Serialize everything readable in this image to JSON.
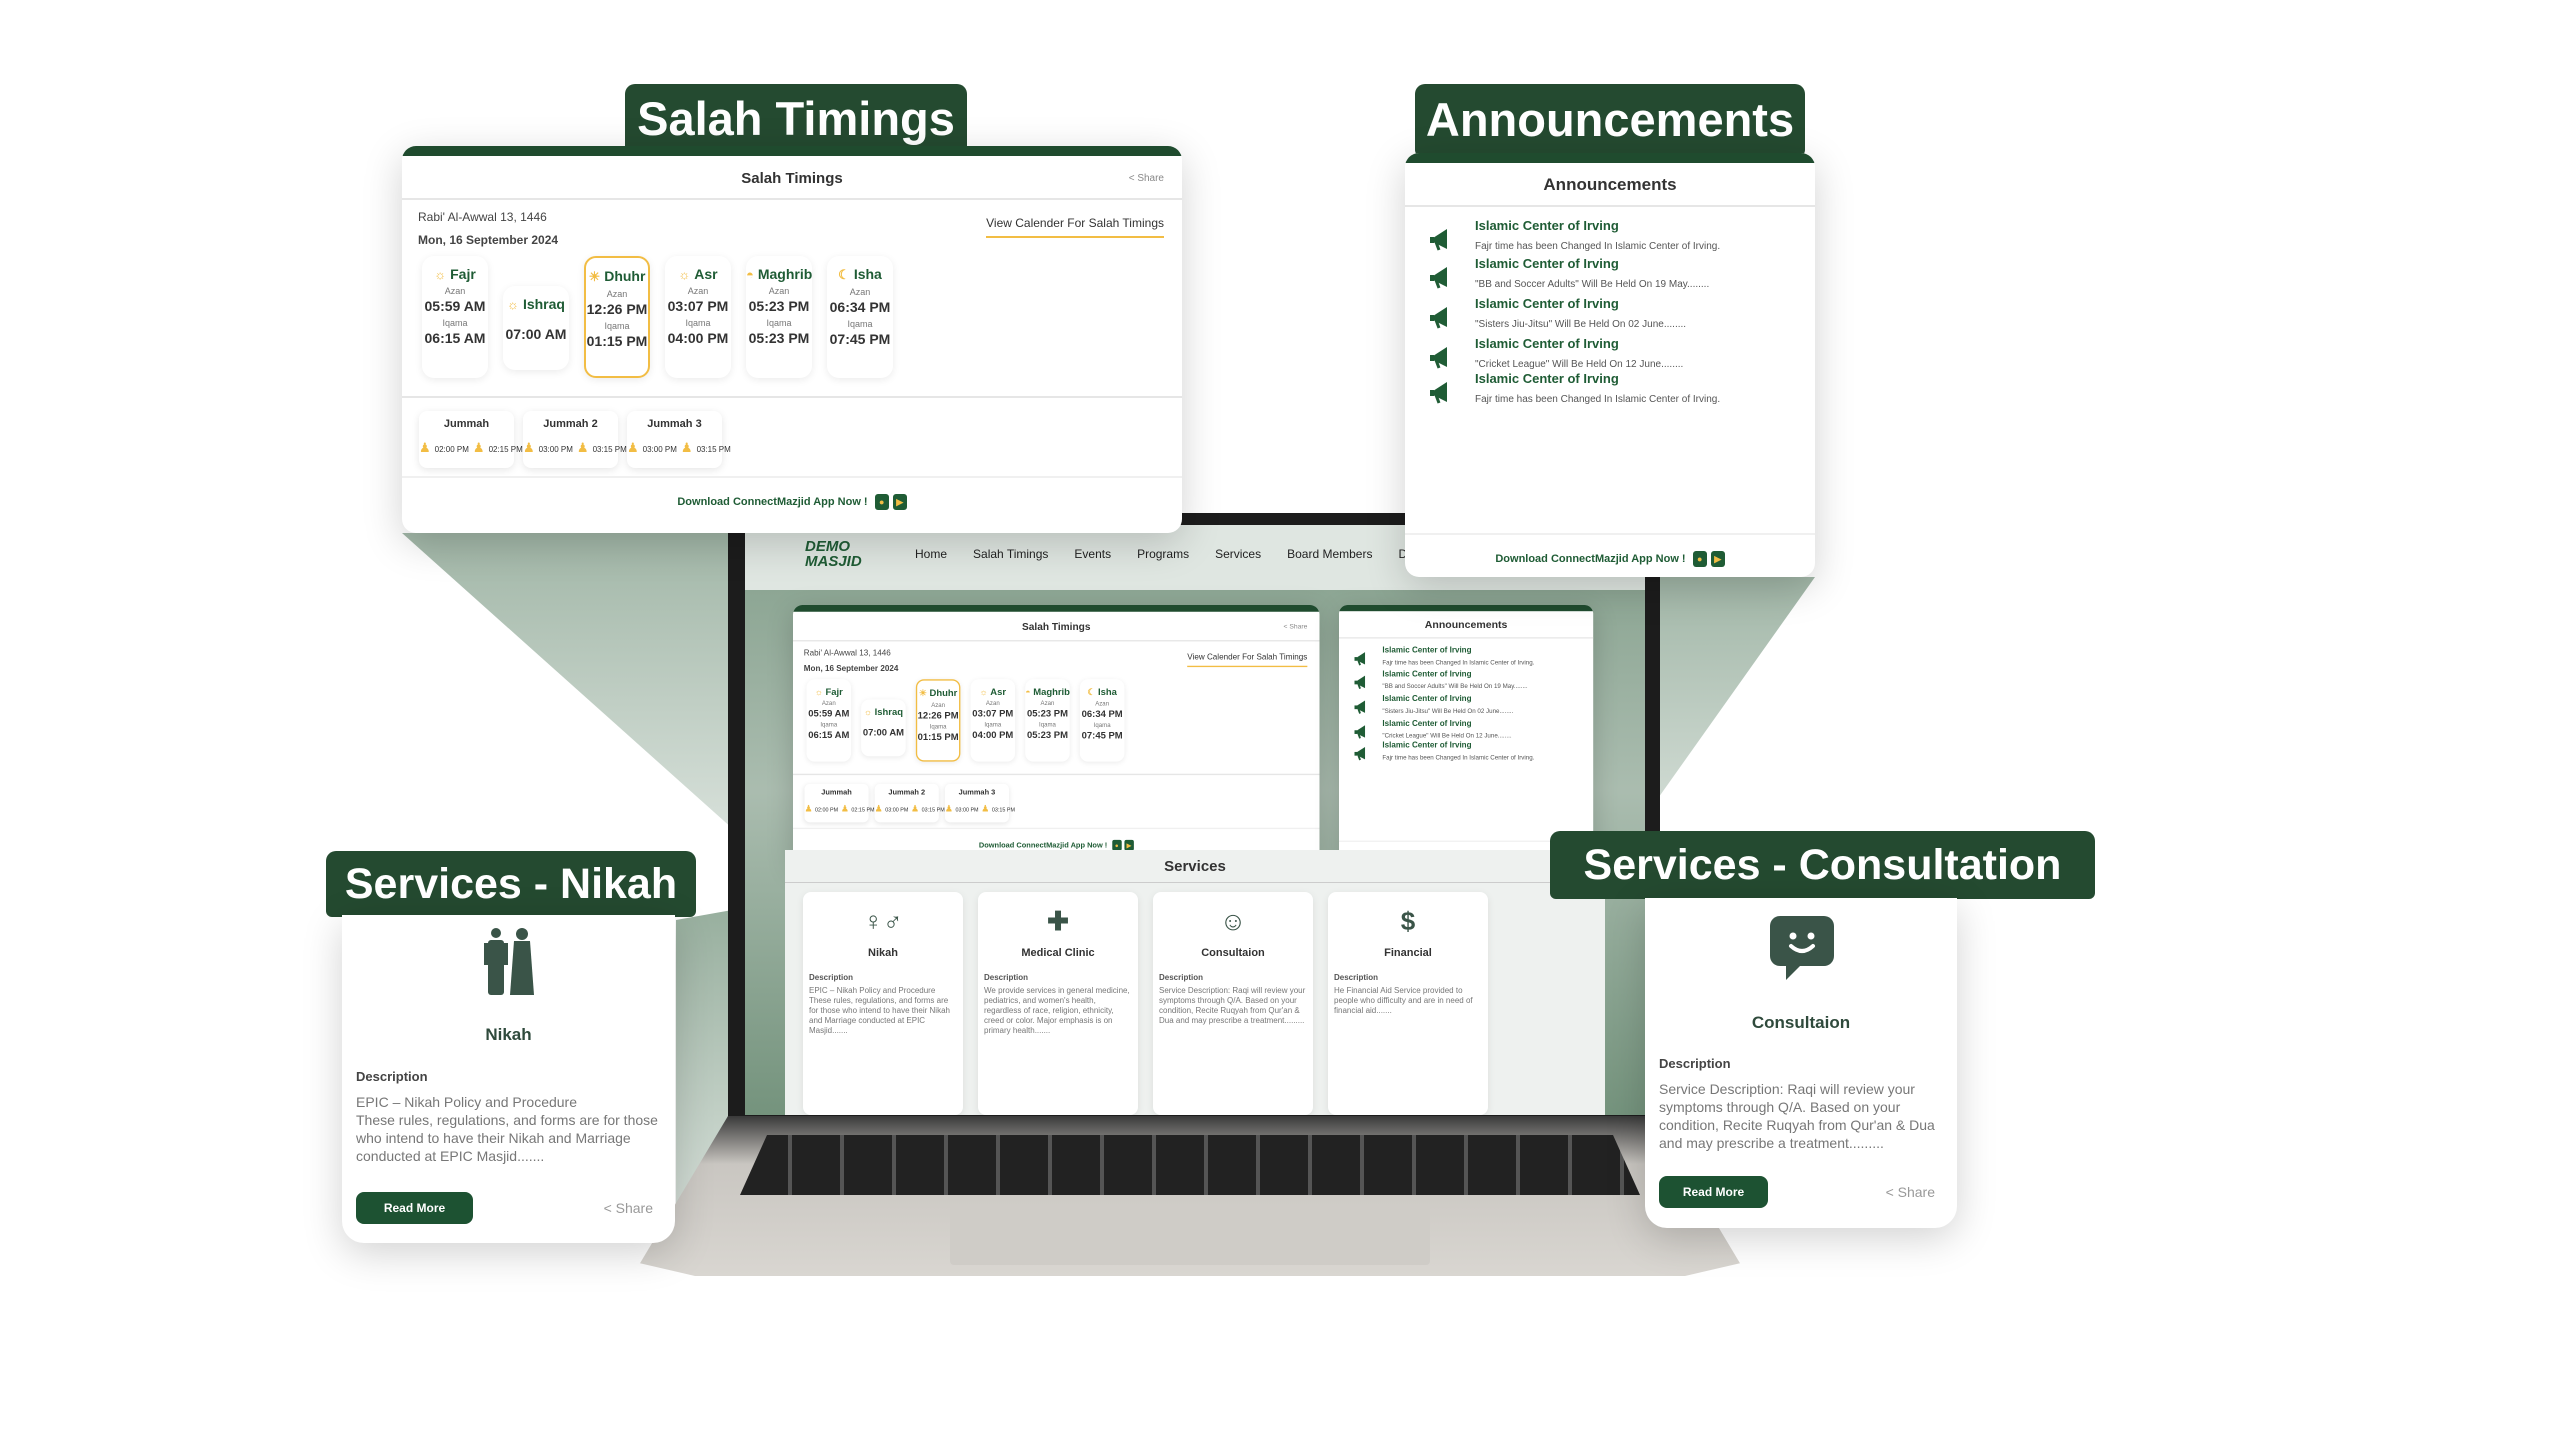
{
  "labels": {
    "salah": "Salah Timings",
    "announcements": "Announcements",
    "nikah": "Services - Nikah",
    "consultation": "Services - Consultation"
  },
  "salah": {
    "title": "Salah Timings",
    "share": "Share",
    "hijri": "Rabi' Al-Awwal 13, 1446",
    "date": "Mon, 16 September 2024",
    "calendar_link": "View Calender For Salah Timings",
    "azan_label": "Azan",
    "iqama_label": "Iqama",
    "prayers": [
      {
        "name": "Fajr",
        "icon": "sunrise-icon",
        "azan": "05:59 AM",
        "iqama": "06:15 AM"
      },
      {
        "name": "Ishraq",
        "icon": "sunrise-icon",
        "time": "07:00 AM"
      },
      {
        "name": "Dhuhr",
        "icon": "sun-icon",
        "azan": "12:26 PM",
        "iqama": "01:15 PM",
        "active": true
      },
      {
        "name": "Asr",
        "icon": "sun-down-icon",
        "azan": "03:07 PM",
        "iqama": "04:00 PM"
      },
      {
        "name": "Maghrib",
        "icon": "sunset-icon",
        "azan": "05:23 PM",
        "iqama": "05:23 PM"
      },
      {
        "name": "Isha",
        "icon": "moon-icon",
        "azan": "06:34 PM",
        "iqama": "07:45 PM"
      }
    ],
    "jummah": [
      {
        "name": "Jummah",
        "khutbah": "02:00 PM",
        "salah": "02:15 PM"
      },
      {
        "name": "Jummah 2",
        "khutbah": "03:00 PM",
        "salah": "03:15 PM"
      },
      {
        "name": "Jummah 3",
        "khutbah": "03:00 PM",
        "salah": "03:15 PM"
      }
    ],
    "download": "Download ConnectMazjid App Now !"
  },
  "announcements": {
    "title": "Announcements",
    "items": [
      {
        "title": "Islamic Center of Irving",
        "text": "Fajr time has been Changed In Islamic Center of Irving."
      },
      {
        "title": "Islamic Center of Irving",
        "text": "\"BB and Soccer Adults\" Will Be Held On 19 May........"
      },
      {
        "title": "Islamic Center of Irving",
        "text": "\"Sisters Jiu-Jitsu\" Will Be Held On 02 June........"
      },
      {
        "title": "Islamic Center of Irving",
        "text": "\"Cricket League\" Will Be Held On 12 June........"
      },
      {
        "title": "Islamic Center of Irving",
        "text": "Fajr time has been Changed In Islamic Center of Irving."
      }
    ],
    "download": "Download ConnectMazjid App Now !"
  },
  "site": {
    "logo": "DEMO\nMASJID",
    "nav": [
      "Home",
      "Salah Timings",
      "Events",
      "Programs",
      "Services",
      "Board Members",
      "Don"
    ],
    "services_title": "Services",
    "services": [
      {
        "name": "Nikah",
        "icon": "couple-icon",
        "desc": "EPIC – Nikah Policy and Procedure These rules, regulations, and forms are for those who intend to have their Nikah and Marriage conducted at EPIC Masjid......."
      },
      {
        "name": "Medical Clinic",
        "icon": "medical-kit-icon",
        "desc": "We provide services in general medicine, pediatrics, and women's health, regardless of race, religion, ethnicity, creed or color. Major emphasis is on primary health......."
      },
      {
        "name": "Consultaion",
        "icon": "chat-smile-icon",
        "desc": "Service Description: Raqi will review your symptoms through Q/A. Based on your condition,  Recite Ruqyah from Qur'an & Dua and may prescribe a treatment........."
      },
      {
        "name": "Financial",
        "icon": "money-bag-icon",
        "desc": "He Financial Aid Service provided to people who difficulty and are in need of financial aid......."
      }
    ]
  },
  "nikah": {
    "title": "Nikah",
    "desc_label": "Description",
    "desc": "EPIC – Nikah Policy and Procedure\nThese rules, regulations, and forms are for those who intend to have their Nikah and Marriage conducted at EPIC Masjid.......",
    "read_more": "Read More",
    "share": "Share"
  },
  "consultation": {
    "title": "Consultaion",
    "desc_label": "Description",
    "desc": "Service Description: Raqi will review your symptoms through Q/A. Based on your condition,  Recite Ruqyah from Qur'an & Dua and may prescribe a treatment.........",
    "read_more": "Read More",
    "share": "Share"
  },
  "description_label": "Description",
  "colors": {
    "brand": "#244a30",
    "accent": "#f2bd44",
    "text_green": "#1f5c35"
  }
}
